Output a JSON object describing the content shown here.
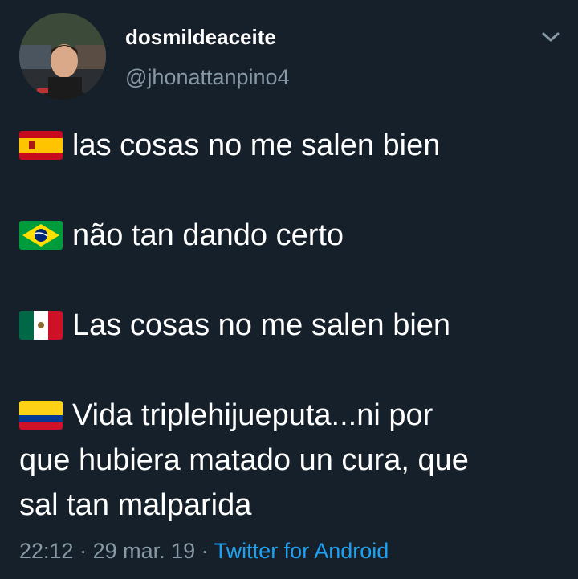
{
  "tweet": {
    "display_name": "dosmildeaceite",
    "handle": "@jhonattanpino4",
    "avatar_text": "dos mil de aceite",
    "lines": [
      {
        "flag": "spain-flag-icon",
        "text": "las cosas no me salen bien"
      },
      {
        "flag": "brazil-flag-icon",
        "text": "não tan dando certo"
      },
      {
        "flag": "mexico-flag-icon",
        "text": "Las cosas no me salen bien"
      },
      {
        "flag": "colombia-flag-icon",
        "text_lines": [
          "Vida triplehijueputa...ni por",
          "que hubiera matado un cura, que",
          "sal tan malparida"
        ]
      }
    ],
    "time": "22:12",
    "separator": " · ",
    "date": "29 mar. 19",
    "source": "Twitter for Android"
  },
  "colors": {
    "background": "#15202b",
    "text": "#ffffff",
    "muted": "#8899a6",
    "link": "#1da1f2"
  },
  "icons": {
    "menu": "chevron-down-icon"
  }
}
